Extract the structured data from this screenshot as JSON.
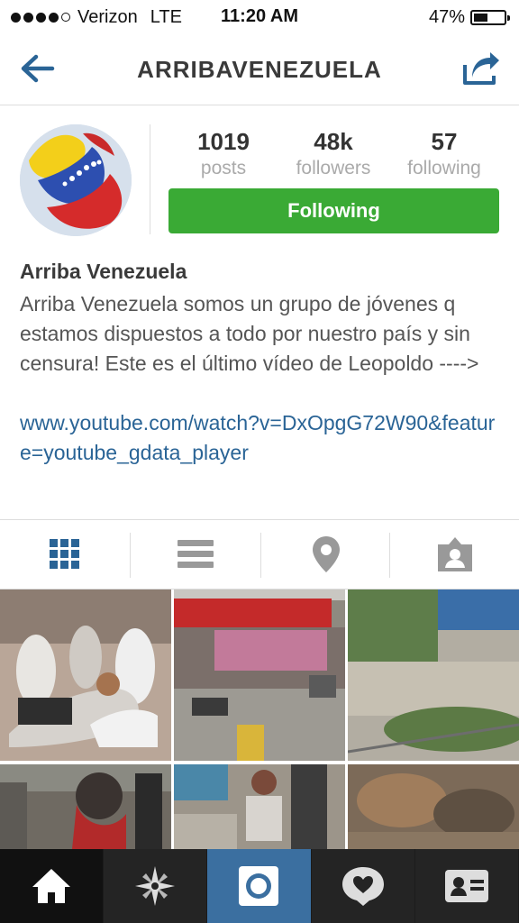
{
  "status_bar": {
    "carrier": "Verizon",
    "network": "LTE",
    "time": "11:20 AM",
    "battery_percent": "47%",
    "battery_level": 0.47
  },
  "nav": {
    "title": "ARRIBAVENEZUELA",
    "back_icon": "back-arrow-icon",
    "share_icon": "share-icon"
  },
  "profile": {
    "stats": [
      {
        "value": "1019",
        "label": "posts"
      },
      {
        "value": "48k",
        "label": "followers"
      },
      {
        "value": "57",
        "label": "following"
      }
    ],
    "follow_button_label": "Following",
    "name": "Arriba Venezuela",
    "bio": "Arriba Venezuela somos un grupo de jóvenes q estamos dispuestos a todo por nuestro país y sin censura! Este es el último vídeo de Leopoldo ---->",
    "link": "www.youtube.com/watch?v=DxOpgG72W90&feature=youtube_gdata_player"
  },
  "view_tabs": [
    "grid-view-icon",
    "list-view-icon",
    "map-pin-icon",
    "tagged-photos-icon"
  ],
  "photos": [
    "photo-1",
    "photo-2",
    "photo-3",
    "photo-4",
    "photo-5",
    "photo-6"
  ],
  "tab_bar": [
    "home-icon",
    "explore-icon",
    "camera-icon",
    "activity-icon",
    "profile-icon"
  ],
  "colors": {
    "follow_green": "#3aaa35",
    "link_blue": "#2a6496",
    "tabbar_dark": "#242424",
    "camera_blue": "#3b6fa0"
  }
}
